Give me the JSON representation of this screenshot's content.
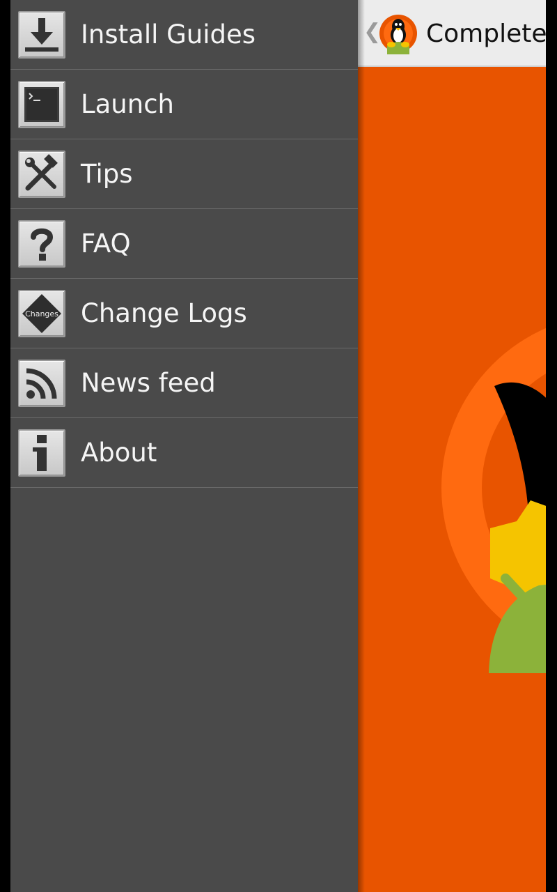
{
  "drawer": {
    "items": [
      {
        "label": "Install Guides",
        "icon": "download-icon"
      },
      {
        "label": "Launch",
        "icon": "terminal-icon"
      },
      {
        "label": "Tips",
        "icon": "tools-icon"
      },
      {
        "label": "FAQ",
        "icon": "question-icon"
      },
      {
        "label": "Change Logs",
        "icon": "changes-icon",
        "icon_text": "Changes"
      },
      {
        "label": "News feed",
        "icon": "rss-icon"
      },
      {
        "label": "About",
        "icon": "info-icon"
      }
    ]
  },
  "action_bar": {
    "title": "Complete L",
    "back_icon": "chevron-left-icon",
    "logo_icon": "linux-android-logo-icon"
  },
  "colors": {
    "drawer_bg": "#4a4a4a",
    "main_bg": "#e85400",
    "ring": "#ff6a10",
    "action_bar_bg": "#ececec"
  }
}
